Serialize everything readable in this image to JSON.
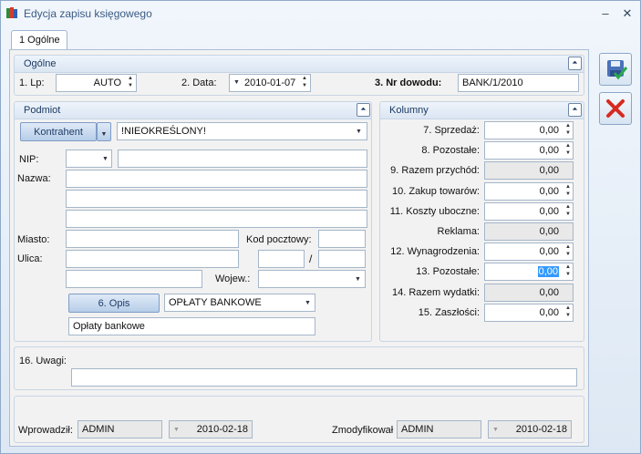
{
  "window": {
    "title": "Edycja zapisu księgowego"
  },
  "tabs": [
    {
      "label": "1 Ogólne"
    }
  ],
  "ogolne": {
    "title": "Ogólne",
    "lp_label": "1. Lp:",
    "lp_value": "AUTO",
    "data_label": "2. Data:",
    "data_value": "2010-01-07",
    "nr_label": "3. Nr dowodu:",
    "nr_value": "BANK/1/2010"
  },
  "podmiot": {
    "title": "Podmiot",
    "kontrahent_button": "Kontrahent",
    "kontrahent_value": "!NIEOKREŚLONY!",
    "nip_label": "NIP:",
    "nazwa_label": "Nazwa:",
    "miasto_label": "Miasto:",
    "kod_label": "Kod pocztowy:",
    "ulica_label": "Ulica:",
    "slash": "/",
    "wojew_label": "Wojew.:",
    "opis_button": "6. Opis",
    "opis_select": "OPŁATY BANKOWE",
    "opis_text": "Opłaty bankowe"
  },
  "kolumny": {
    "title": "Kolumny",
    "rows": [
      {
        "label": "7. Sprzedaż:",
        "value": "0,00",
        "readonly": false
      },
      {
        "label": "8. Pozostałe:",
        "value": "0,00",
        "readonly": false
      },
      {
        "label": "9. Razem przychód:",
        "value": "0,00",
        "readonly": true
      },
      {
        "label": "10. Zakup towarów:",
        "value": "0,00",
        "readonly": false
      },
      {
        "label": "11. Koszty uboczne:",
        "value": "0,00",
        "readonly": false
      },
      {
        "label": "Reklama:",
        "value": "0,00",
        "readonly": true
      },
      {
        "label": "12. Wynagrodzenia:",
        "value": "0,00",
        "readonly": false
      },
      {
        "label": "13. Pozostałe:",
        "value": "0,00",
        "readonly": false
      },
      {
        "label": "14. Razem wydatki:",
        "value": "0,00",
        "readonly": true
      },
      {
        "label": "15. Zaszłości:",
        "value": "0,00",
        "readonly": false
      }
    ]
  },
  "uwagi": {
    "label": "16. Uwagi:"
  },
  "footer": {
    "wprowadzil_label": "Wprowadził:",
    "wprowadzil_user": "ADMIN",
    "wprowadzil_date": "2010-02-18",
    "zmodyfikowal_label": "Zmodyfikował",
    "zmodyfikowal_user": "ADMIN",
    "zmodyfikowal_date": "2010-02-18"
  }
}
